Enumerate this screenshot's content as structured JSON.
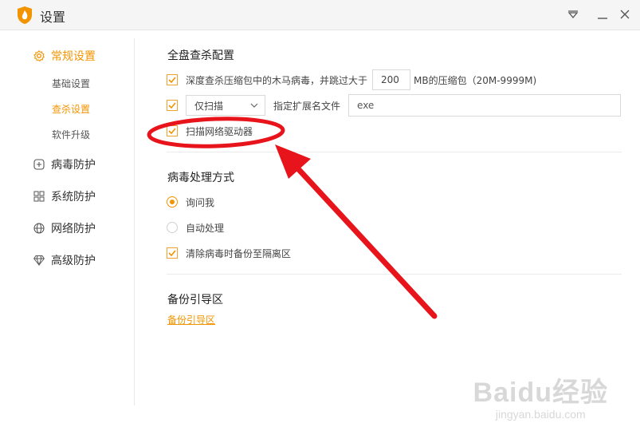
{
  "window": {
    "title": "设置",
    "accent_color": "#f29400",
    "icons": [
      "shield-logo-icon",
      "dropdown-menu-icon",
      "minimize-icon",
      "close-icon"
    ]
  },
  "sidebar": {
    "general": {
      "label": "常规设置",
      "icon": "gear-icon",
      "sub_items": [
        {
          "label": "基础设置",
          "active": false
        },
        {
          "label": "查杀设置",
          "active": true
        },
        {
          "label": "软件升级",
          "active": false
        }
      ]
    },
    "items": [
      {
        "label": "病毒防护",
        "icon": "plus-square-icon"
      },
      {
        "label": "系统防护",
        "icon": "grid-icon"
      },
      {
        "label": "网络防护",
        "icon": "globe-icon"
      },
      {
        "label": "高级防护",
        "icon": "diamond-icon"
      }
    ]
  },
  "full_scan": {
    "title": "全盘查杀配置",
    "compressed": {
      "checked": true,
      "label_before": "深度查杀压缩包中的木马病毒，并跳过大于",
      "size_value": "200",
      "label_after": "MB的压缩包（20M-9999M)"
    },
    "scan_mode": {
      "checked": true,
      "selected": "仅扫描",
      "ext_label": "指定扩展名文件",
      "ext_value": "exe"
    },
    "network_driver": {
      "checked": true,
      "label": "扫描网络驱动器"
    }
  },
  "virus_handling": {
    "title": "病毒处理方式",
    "options": [
      {
        "label": "询问我",
        "selected": true
      },
      {
        "label": "自动处理",
        "selected": false
      }
    ],
    "backup": {
      "checked": true,
      "label": "清除病毒时备份至隔离区"
    }
  },
  "boot_backup": {
    "title": "备份引导区",
    "link": "备份引导区"
  },
  "annotation": {
    "color": "#e8141c"
  },
  "watermark": {
    "brand": "Baidu经验",
    "url": "jingyan.baidu.com"
  }
}
